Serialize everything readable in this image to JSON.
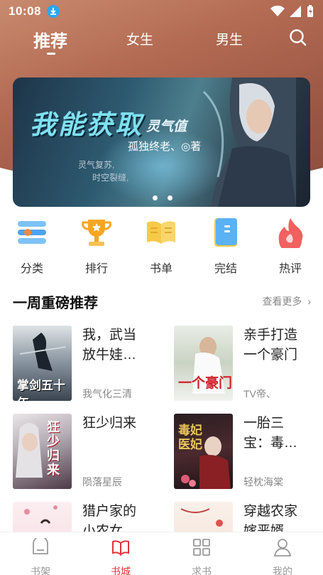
{
  "status": {
    "time": "10:08"
  },
  "top_tabs": [
    {
      "label": "推荐",
      "active": true
    },
    {
      "label": "女生",
      "active": false
    },
    {
      "label": "男生",
      "active": false
    }
  ],
  "banner": {
    "title": "我能获取",
    "subtitle": "灵气值",
    "author": "孤独终老、◎著",
    "tagline_1": "灵气复苏,",
    "tagline_2": "时空裂缝,",
    "page_count": 2
  },
  "categories": [
    {
      "label": "分类",
      "icon": "list-icon",
      "color": "#4ea3f0"
    },
    {
      "label": "排行",
      "icon": "trophy-icon",
      "color": "#f6a623"
    },
    {
      "label": "书单",
      "icon": "open-book-icon",
      "color": "#f7c948"
    },
    {
      "label": "完结",
      "icon": "closed-book-icon",
      "color": "#5ab2f5"
    },
    {
      "label": "热评",
      "icon": "flame-icon",
      "color": "#f26060"
    }
  ],
  "section": {
    "title": "一周重磅推荐",
    "more": "查看更多"
  },
  "books": [
    {
      "title": "我，武当放牛娃…",
      "author": "我气化三清",
      "cover_text": "掌剑五十年"
    },
    {
      "title": "亲手打造一个豪门",
      "author": "TV帝、",
      "cover_text": "一个豪门"
    },
    {
      "title": "狂少归来",
      "author": "陨落星辰",
      "cover_text": "狂少归来"
    },
    {
      "title": "一胎三宝：毒…",
      "author": "轻枕海棠",
      "cover_text": "毒妃医妃"
    },
    {
      "title": "猎户家的小农女",
      "author": "",
      "cover_text": ""
    },
    {
      "title": "穿越农家嫁恶婿",
      "author": "",
      "cover_text": ""
    }
  ],
  "bottom_nav": [
    {
      "label": "书架",
      "active": false
    },
    {
      "label": "书城",
      "active": true
    },
    {
      "label": "求书",
      "active": false
    },
    {
      "label": "我的",
      "active": false
    }
  ],
  "colors": {
    "accent": "#e0343c",
    "header": "#b26a52"
  }
}
